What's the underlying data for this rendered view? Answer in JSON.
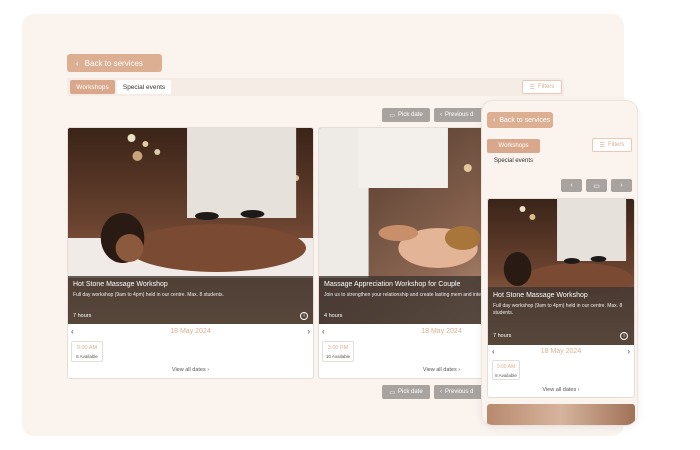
{
  "desktop": {
    "back_label": "Back to services",
    "tabs": [
      {
        "label": "Workshops"
      },
      {
        "label": "Special events"
      }
    ],
    "filters_label": "Filters",
    "pick_date_label": "Pick date",
    "previous_label": "Previous d",
    "cards": [
      {
        "title": "Hot Stone Massage Workshop",
        "description": "Full day workshop (9am to 4pm) held in our centre. Max. 8 students.",
        "duration": "7 hours",
        "date": "18 May 2024",
        "slot_time": "9:00 AM",
        "slot_avail": "8 Available",
        "view_all": "View all dates"
      },
      {
        "title": "Massage Appreciation Workshop for Couple",
        "description": "Join us to strengthen your relationship and create lasting mem and interactive setting.",
        "duration": "4 hours",
        "date": "18 May 2024",
        "slot_time": "3:00 PM",
        "slot_avail": "10 Available",
        "view_all": "View all dates"
      }
    ]
  },
  "mobile": {
    "back_label": "Back to services",
    "filters_label": "Filters",
    "tabs": [
      {
        "label": "Workshops"
      },
      {
        "label": "Special events"
      }
    ],
    "card": {
      "title": "Hot Stone Massage Workshop",
      "description": "Full day workshop (9am to 4pm) held in our centre. Max. 8 students.",
      "duration": "7 hours",
      "date": "18 May 2024",
      "slot_time": "9:00 AM",
      "slot_avail": "8 Available",
      "view_all": "View all dates"
    }
  },
  "colors": {
    "accent": "#dcae92",
    "panel_bg": "#faf3ee",
    "button_gray": "#a9a3a0"
  }
}
